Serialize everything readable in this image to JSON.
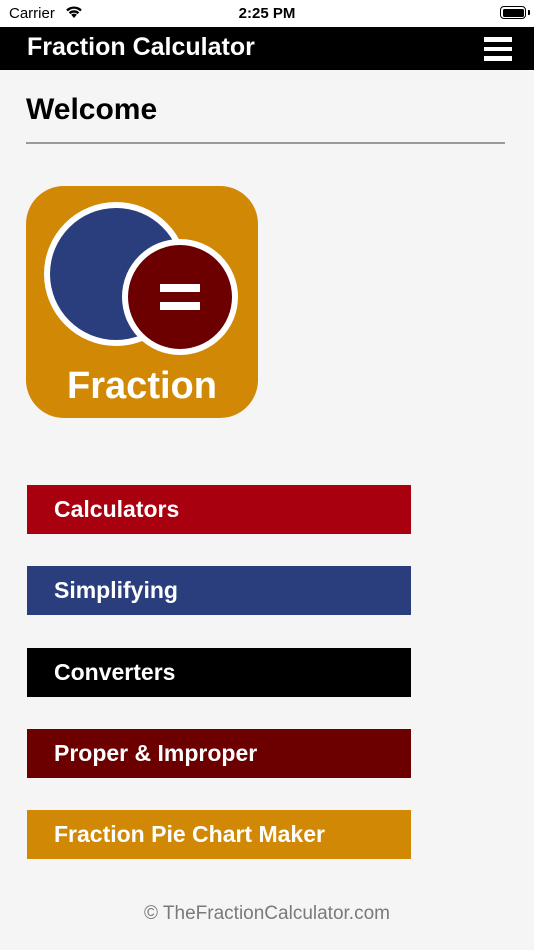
{
  "status_bar": {
    "carrier": "Carrier",
    "time": "2:25 PM"
  },
  "header": {
    "title": "Fraction Calculator",
    "menu_icon": "hamburger-menu-icon"
  },
  "main": {
    "heading": "Welcome",
    "logo_text": "Fraction",
    "menu_items": [
      {
        "label": "Calculators",
        "color": "#a8000f"
      },
      {
        "label": "Simplifying",
        "color": "#2a3e7e"
      },
      {
        "label": "Converters",
        "color": "#000000"
      },
      {
        "label": "Proper & Improper",
        "color": "#6c0000"
      },
      {
        "label": "Fraction Pie Chart Maker",
        "color": "#d18805"
      }
    ]
  },
  "footer": {
    "text": "© TheFractionCalculator.com"
  },
  "colors": {
    "logo_bg": "#d18805",
    "logo_circle_blue": "#2a3e7e",
    "logo_circle_red": "#6c0000"
  }
}
